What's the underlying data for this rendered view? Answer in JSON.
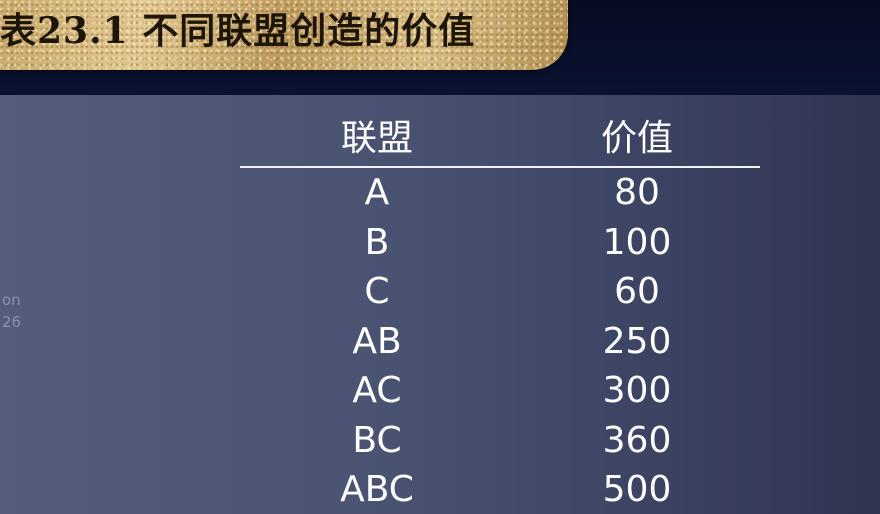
{
  "title": "表23.1  不同联盟创造的价值",
  "side_fragment": [
    "on",
    "26"
  ],
  "table": {
    "headers": [
      "联盟",
      "价值"
    ],
    "rows": [
      [
        "A",
        "80"
      ],
      [
        "B",
        "100"
      ],
      [
        "C",
        "60"
      ],
      [
        "AB",
        "250"
      ],
      [
        "AC",
        "300"
      ],
      [
        "BC",
        "360"
      ],
      [
        "ABC",
        "500"
      ]
    ]
  }
}
